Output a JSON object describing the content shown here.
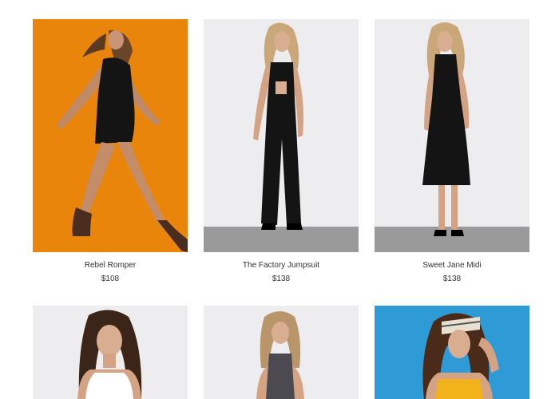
{
  "products": [
    {
      "name": "Rebel Romper",
      "price": "$108"
    },
    {
      "name": "The Factory Jumpsuit",
      "price": "$138"
    },
    {
      "name": "Sweet Jane Midi",
      "price": "$138"
    },
    {
      "name": "",
      "price": ""
    },
    {
      "name": "",
      "price": ""
    },
    {
      "name": "",
      "price": ""
    }
  ],
  "colors": {
    "orange_bg": "#EE8B0A",
    "studio_bg": "#EDEDEF",
    "floor": "#9A9A9A",
    "blue_bg": "#2F9BD6",
    "garment": "#141414"
  }
}
